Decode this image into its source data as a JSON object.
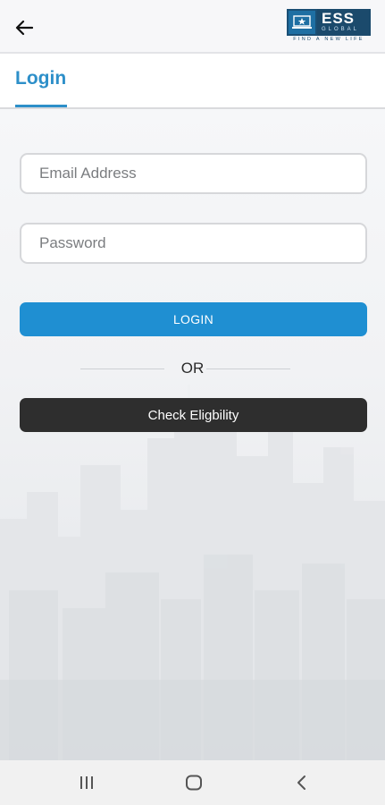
{
  "header": {
    "back_icon": "arrow-left-icon",
    "logo": {
      "brand": "ESS",
      "sub": "GLOBAL",
      "tagline": "FIND A NEW LIFE",
      "colors": {
        "primary": "#1b4a6c",
        "accent": "#1e6fa3"
      }
    }
  },
  "tabs": [
    {
      "label": "Login",
      "active": true
    }
  ],
  "form": {
    "email": {
      "placeholder": "Email Address",
      "value": ""
    },
    "password": {
      "placeholder": "Password",
      "value": ""
    },
    "login_button": "LOGIN",
    "divider_text": "OR",
    "eligibility_button": "Check Eligbility"
  },
  "nav": {
    "recents_icon": "recents-icon",
    "home_icon": "home-icon",
    "back_icon": "chevron-left-icon"
  },
  "colors": {
    "accent": "#1f8fd2",
    "tab_active": "#2d8fc9",
    "dark_button": "#2e2e2e"
  }
}
